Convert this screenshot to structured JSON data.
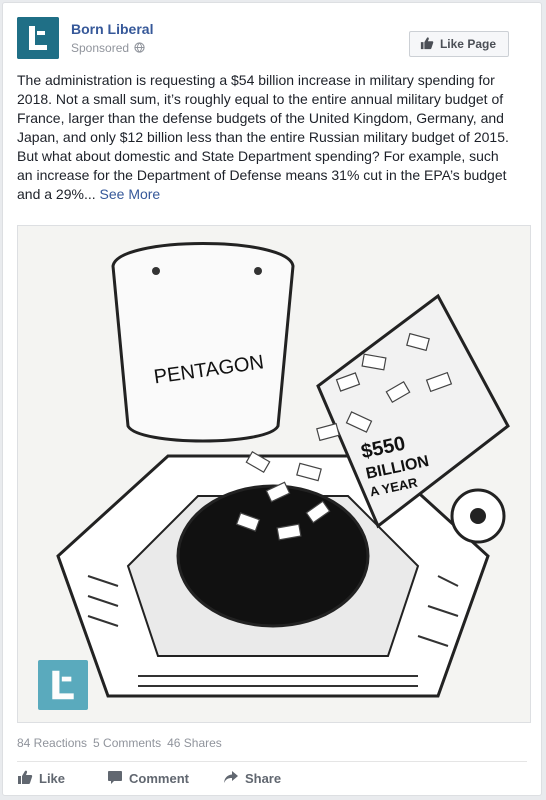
{
  "post": {
    "page_name": "Born Liberal",
    "sponsored_label": "Sponsored",
    "like_page_label": "Like Page",
    "text_body": "The administration is requesting a $54 billion increase in military spending for 2018. Not a small sum, it’s roughly equal to the entire annual military budget of France, larger than the defense budgets of the United Kingdom, Germany, and Japan, and only $12 billion less than the entire Russian military budget of 2015. But what about domestic and State Department spending? For example, such an increase for the Department of Defense means 31% cut in the EPA’s budget and a 29%...",
    "see_more_label": "See More"
  },
  "cartoon": {
    "pentagon_label": "PENTAGON",
    "money_line1": "$550",
    "money_line2": "BILLION",
    "money_line3": "A YEAR"
  },
  "stats": {
    "reactions": "84 Reactions",
    "comments": "5 Comments",
    "shares": "46 Shares"
  },
  "actions": {
    "like": "Like",
    "comment": "Comment",
    "share": "Share"
  },
  "icons": {
    "globe": "globe-icon",
    "thumbs_up": "thumbs-up-icon",
    "comment": "comment-icon",
    "share": "share-icon"
  },
  "colors": {
    "link": "#365899",
    "brand_teal": "#1f6f86",
    "muted": "#90949c"
  }
}
